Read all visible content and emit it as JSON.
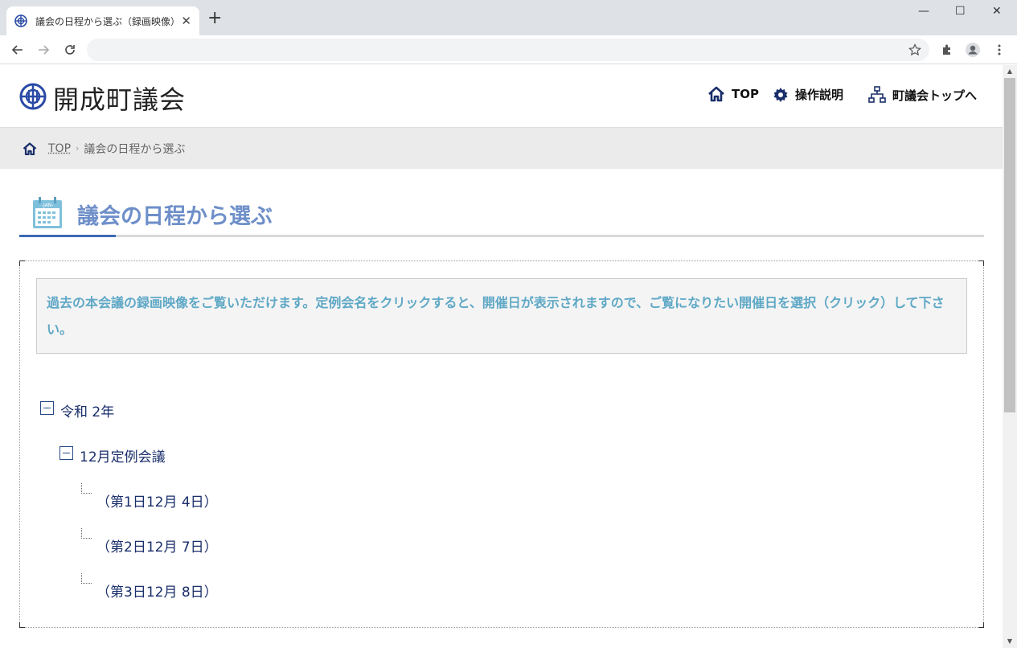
{
  "browser": {
    "tab_title": "議会の日程から選ぶ（録画映像）",
    "new_tab": "+",
    "window_controls": {
      "minimize": "—",
      "maximize": "☐",
      "close": "✕"
    },
    "address": ""
  },
  "site": {
    "logo_text": "開成町議会",
    "nav": [
      {
        "label": "TOP",
        "icon": "home-icon"
      },
      {
        "label": "操作説明",
        "icon": "gear-icon"
      },
      {
        "label": "町議会トップへ",
        "icon": "sitemap-icon"
      }
    ]
  },
  "breadcrumb": {
    "home": "TOP",
    "separator": "›",
    "current": "議会の日程から選ぶ"
  },
  "page": {
    "title": "議会の日程から選ぶ",
    "calendar_icon_text": "-JAN-",
    "notice": "過去の本会議の録画映像をご覧いただけます。定例会名をクリックすると、開催日が表示されますので、ご覧になりたい開催日を選択（クリック）して下さい。"
  },
  "tree": {
    "year": "令和 2年",
    "session": "12月定例会議",
    "days": [
      "（第1日12月 4日）",
      "（第2日12月 7日）",
      "（第3日12月 8日）"
    ]
  },
  "colors": {
    "brand_blue": "#1a2f6b",
    "title_blue": "#6e8fc9",
    "notice_text": "#5fa8c6",
    "accent": "#3c69b5"
  }
}
